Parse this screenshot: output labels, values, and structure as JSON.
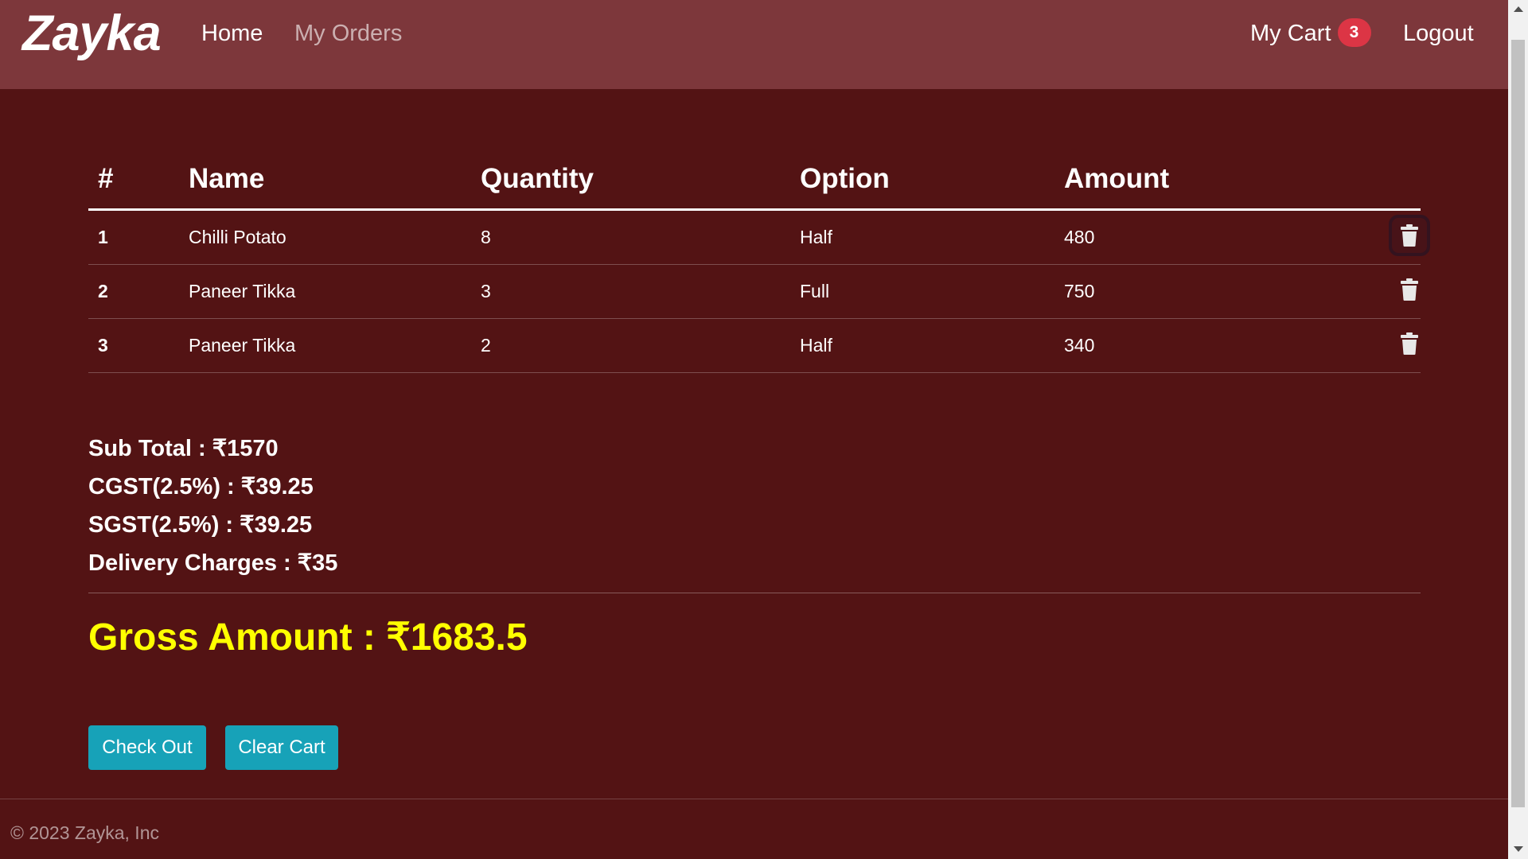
{
  "nav": {
    "brand": "Zayka",
    "home": "Home",
    "my_orders": "My Orders",
    "my_cart": "My Cart",
    "cart_count": "3",
    "logout": "Logout"
  },
  "table": {
    "headers": [
      "#",
      "Name",
      "Quantity",
      "Option",
      "Amount"
    ],
    "rows": [
      {
        "index": "1",
        "name": "Chilli Potato",
        "quantity": "8",
        "option": "Half",
        "amount": "480"
      },
      {
        "index": "2",
        "name": "Paneer Tikka",
        "quantity": "3",
        "option": "Full",
        "amount": "750"
      },
      {
        "index": "3",
        "name": "Paneer Tikka",
        "quantity": "2",
        "option": "Half",
        "amount": "340"
      }
    ],
    "delete_icon": "trash-icon"
  },
  "summary": {
    "sub_total": "Sub Total : ₹1570",
    "cgst": "CGST(2.5%) : ₹39.25",
    "sgst": "SGST(2.5%) : ₹39.25",
    "delivery": "Delivery Charges : ₹35",
    "gross": "Gross Amount : ₹1683.5"
  },
  "buttons": {
    "checkout": "Check Out",
    "clear_cart": "Clear Cart"
  },
  "footer": {
    "copyright": "© 2023 Zayka, Inc"
  },
  "colors": {
    "navbar": "#7d373b",
    "background": "#531314",
    "gross_amount": "#ffff00",
    "button": "#17a2b8",
    "badge": "#dc3545"
  }
}
